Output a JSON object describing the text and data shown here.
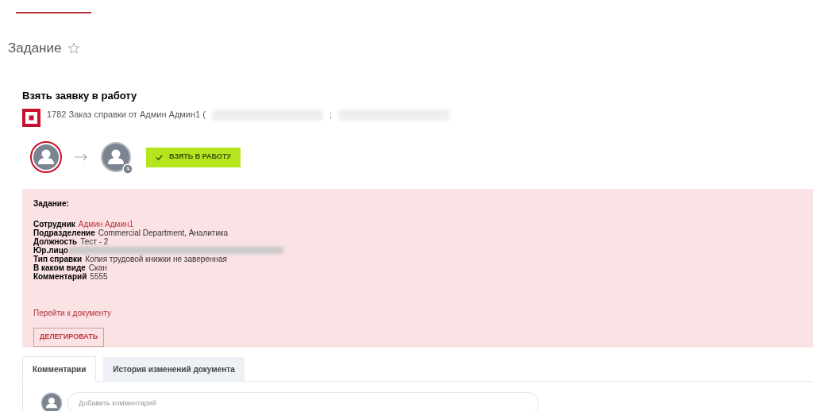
{
  "page_title": "Задание",
  "favorite": false,
  "task": {
    "title": "Взять заявку в работу",
    "request": "1782 Заказ справки от Админ Админ1 (",
    "separator": ";"
  },
  "action_button": "ВЗЯТЬ В РАБОТУ",
  "details": {
    "heading": "Задание:",
    "fields": [
      {
        "label": "Сотрудник",
        "value": "Админ Админ1",
        "kind": "link"
      },
      {
        "label": "Подразделение",
        "value": "Commercial Department, Аналитика",
        "kind": "plain"
      },
      {
        "label": "Должность",
        "value": "Тест - 2",
        "kind": "plain"
      },
      {
        "label": "Юр.лицо",
        "kind": "redacted"
      },
      {
        "label": "Тип справки",
        "value": "Копия трудовой книжки не заверенная",
        "kind": "plain"
      },
      {
        "label": "В каком виде",
        "value": "Скан",
        "kind": "plain"
      },
      {
        "label": "Комментарий",
        "value": "5555",
        "kind": "plain"
      }
    ],
    "link": "Перейти к документу",
    "delegate_button": "ДЕЛЕГИРОВАТЬ"
  },
  "tabs": [
    {
      "label": "Комментарии",
      "selected": true
    },
    {
      "label": "История изменений документа",
      "selected": false
    }
  ],
  "comment": {
    "placeholder": "Добавить комментарий"
  }
}
